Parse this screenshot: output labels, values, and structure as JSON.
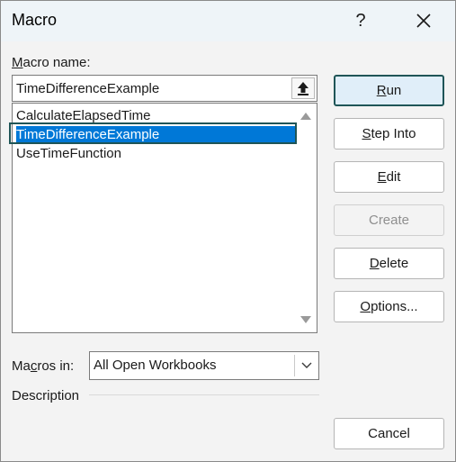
{
  "dialog": {
    "title": "Macro",
    "help_label": "?",
    "close_icon": "close-icon"
  },
  "macro_name": {
    "label_first": "M",
    "label_rest": "acro name:",
    "value": "TimeDifferenceExample",
    "upload_icon": "upload-arrow-icon"
  },
  "macro_list": {
    "items": [
      {
        "label": "CalculateElapsedTime",
        "selected": false
      },
      {
        "label": "TimeDifferenceExample",
        "selected": true
      },
      {
        "label": "UseTimeFunction",
        "selected": false
      }
    ]
  },
  "macros_in": {
    "label_first": "Ma",
    "label_underlined": "c",
    "label_rest": "ros in:",
    "value": "All Open Workbooks"
  },
  "description": {
    "label": "Description"
  },
  "buttons": {
    "run": {
      "mnemonic": "R",
      "rest": "un"
    },
    "step_into": {
      "mnemonic": "S",
      "rest": "tep Into"
    },
    "edit": {
      "mnemonic": "E",
      "rest": "dit"
    },
    "create": {
      "label": "Create",
      "disabled": true
    },
    "delete": {
      "mnemonic": "D",
      "rest": "elete"
    },
    "options": {
      "mnemonic": "O",
      "rest": "ptions..."
    },
    "cancel": {
      "label": "Cancel"
    }
  },
  "colors": {
    "selection": "#0078d7",
    "focus_frame": "#1f5557",
    "default_button_bg": "#e0eef9"
  }
}
